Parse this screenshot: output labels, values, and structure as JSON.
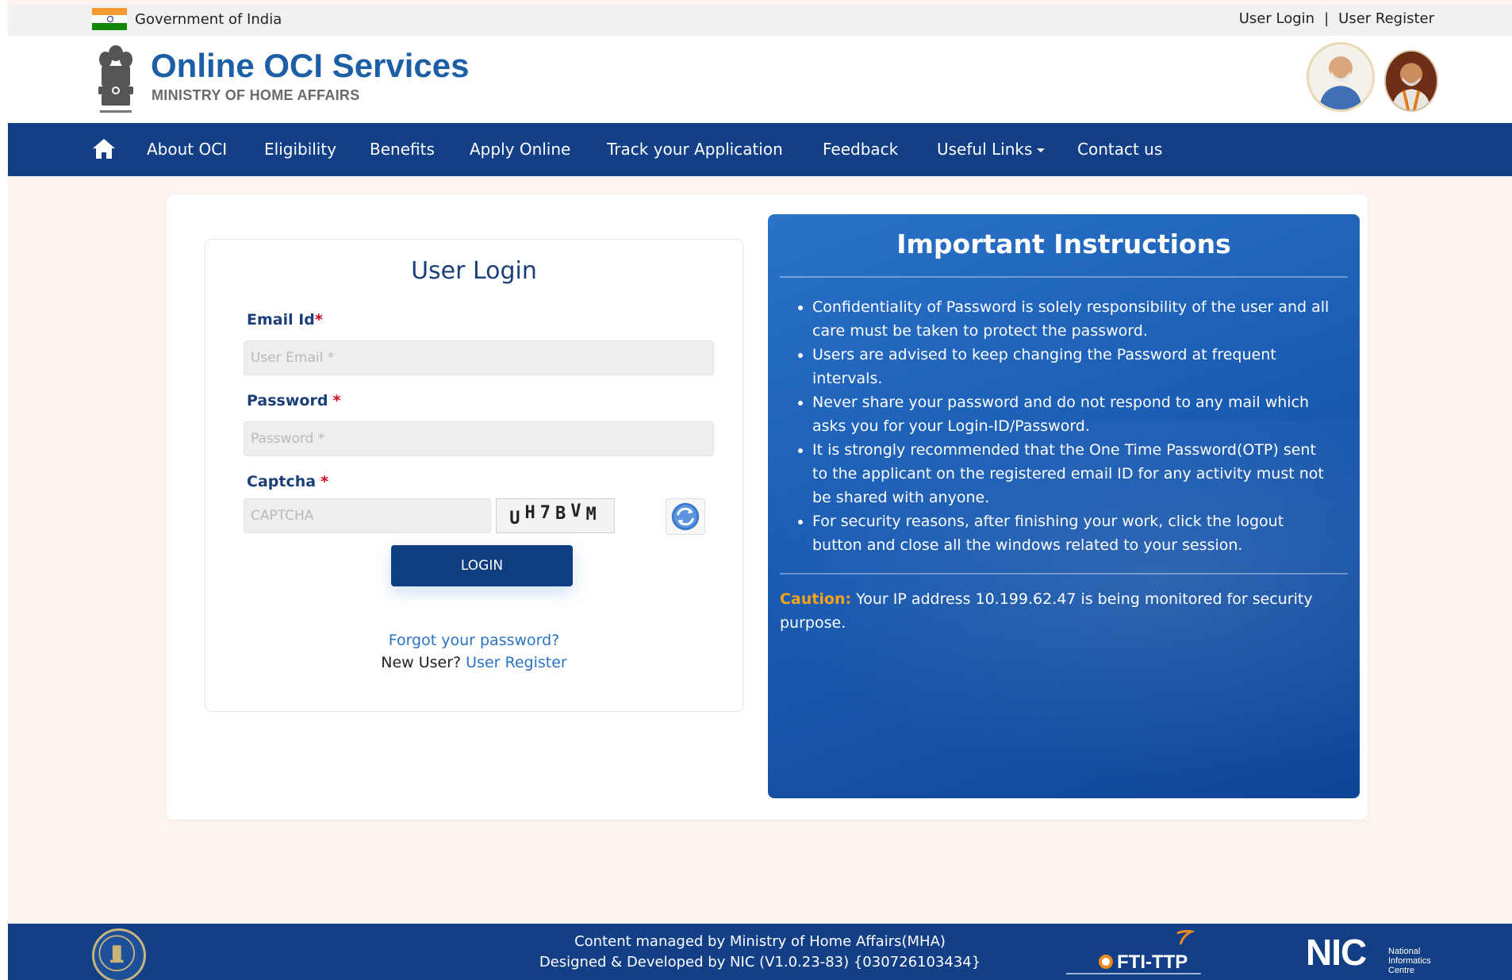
{
  "gov_strip": {
    "label": "Government of India",
    "links": {
      "login": "User Login",
      "separator": "|",
      "register": "User Register"
    }
  },
  "header": {
    "title": "Online OCI Services",
    "subtitle": "MINISTRY OF HOME AFFAIRS"
  },
  "nav": {
    "items": [
      "About OCI",
      "Eligibility",
      "Benefits",
      "Apply Online",
      "Track your Application",
      "Feedback",
      "Useful Links",
      "Contact us"
    ]
  },
  "login": {
    "title": "User Login",
    "email_label": "Email Id",
    "email_placeholder": "User Email *",
    "password_label": "Password",
    "password_placeholder": "Password *",
    "captcha_label": "Captcha",
    "captcha_placeholder": "CAPTCHA",
    "captcha_text": [
      "U",
      "H",
      "7",
      "B",
      "V",
      "M"
    ],
    "required_mark": "*",
    "login_button": "LOGIN",
    "forgot_link": "Forgot your password?",
    "new_user_text": "New User?",
    "register_link": "User Register"
  },
  "instructions": {
    "title": "Important Instructions",
    "items": [
      "Confidentiality of Password is solely responsibility of the user and all care must be taken to protect the password.",
      "Users are advised to keep changing the Password at frequent intervals.",
      "Never share your password and do not respond to any mail which asks you for your Login-ID/Password.",
      "It is strongly recommended that the One Time Password(OTP) sent to the applicant on the registered email ID for any activity must not be shared with anyone.",
      "For security reasons, after finishing your work, click the logout button and close all the windows related to your session."
    ],
    "caution_label": "Caution:",
    "caution_text": " Your IP address 10.199.62.47 is being monitored for security purpose."
  },
  "footer": {
    "line1": "Content managed by Ministry of Home Affairs(MHA)",
    "line2": "Designed & Developed by NIC (V1.0.23-83) {030726103434}",
    "ftt_logo_text": "FTI-TTP",
    "nic_logo_text": "NIC",
    "nic_logo_sub": "National Informatics Centre"
  },
  "colors": {
    "nav_bg": "#123f86",
    "title_blue": "#1d5fa6",
    "link_blue": "#2a72c4",
    "caution_orange": "#f7a21a",
    "page_bg": "#fdf3ef"
  }
}
